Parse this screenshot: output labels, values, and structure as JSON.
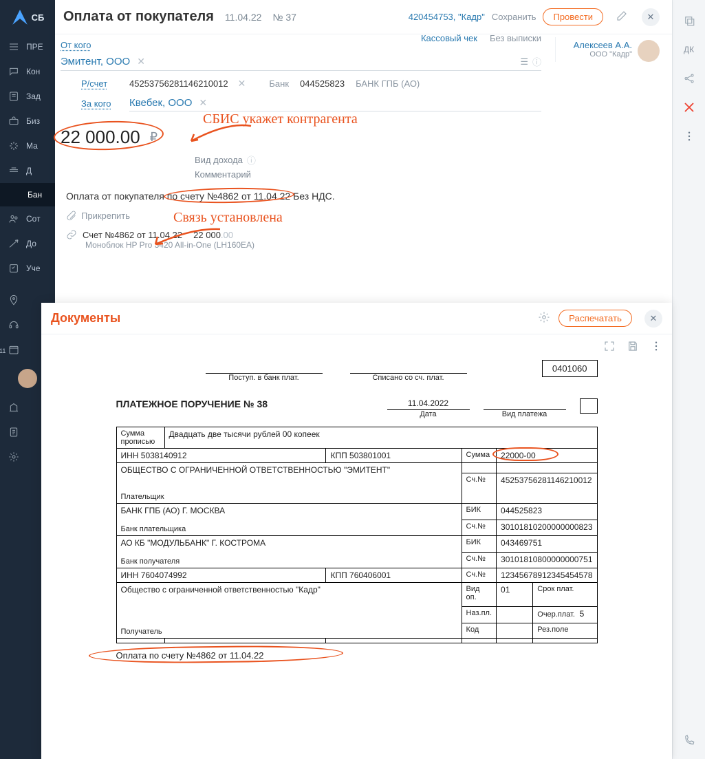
{
  "sidebar": {
    "brand": "СБ",
    "items": [
      {
        "icon": "menu",
        "label": "ПРЕ"
      },
      {
        "icon": "chat",
        "label": "Кон"
      },
      {
        "icon": "tasks",
        "label": "Зад"
      },
      {
        "icon": "briefcase",
        "label": "Биз"
      },
      {
        "icon": "spark",
        "label": "Ма"
      },
      {
        "icon": "money",
        "label": "Д"
      },
      {
        "icon": "",
        "label": "Бан",
        "sub": true,
        "active": true
      },
      {
        "icon": "people",
        "label": "Сот"
      },
      {
        "icon": "send",
        "label": "До"
      },
      {
        "icon": "ledger",
        "label": "Уче"
      },
      {
        "icon": "",
        "label": ""
      },
      {
        "icon": "geo",
        "label": ""
      },
      {
        "icon": "headset",
        "label": ""
      },
      {
        "icon": "calendar",
        "label": "11"
      },
      {
        "icon": "avatar",
        "label": ""
      },
      {
        "icon": "bank",
        "label": ""
      },
      {
        "icon": "clipboard",
        "label": ""
      },
      {
        "icon": "gear",
        "label": ""
      }
    ]
  },
  "topbar": {
    "title": "Оплата от покупателя",
    "date": "11.04.22",
    "num": "№ 37",
    "org_ref": "420454753, \"Кадр\"",
    "save": "Сохранить",
    "submit": "Провести"
  },
  "statement": {
    "cashcheck": "Кассовый чек",
    "nostatement": "Без выписки"
  },
  "person": {
    "name": "Алексеев А.А.",
    "company": "ООО \"Кадр\""
  },
  "form": {
    "from_lbl": "От кого",
    "from_company": "Эмитент, ООО",
    "acc_lbl": "Р/счет",
    "acc_value": "45253756281146210012",
    "bank_lbl": "Банк",
    "bik_value": "044525823",
    "bank_name": "БАНК ГПБ (АО)",
    "for_lbl": "За кого",
    "for_company": "Квебек, ООО",
    "amount": "22 000.00",
    "currency": "₽",
    "income_type_lbl": "Вид дохода",
    "comment_lbl": "Комментарий",
    "hw1": "СБИС укажет контрагента",
    "hw2": "Связь установлена"
  },
  "desc": "Оплата от покупателя по счету №4862 от 11.04.22 Без НДС.",
  "desc_highlight": "по счету №4862 от 11.04.22",
  "attach_lbl": "Прикрепить",
  "linked": {
    "title": "Счет №4862 от 11.04.22",
    "amount_main": "22 000",
    "amount_dec": ".00",
    "sub": "Моноблок HP Pro 3420 All-in-One (LH160EA)"
  },
  "docpanel": {
    "title": "Документы",
    "print": "Распечатать"
  },
  "po": {
    "code": "0401060",
    "lbl_in": "Поступ. в банк плат.",
    "lbl_out": "Списано со сч. плат.",
    "heading": "ПЛАТЕЖНОЕ ПОРУЧЕНИЕ № 38",
    "date": "11.04.2022",
    "date_lbl": "Дата",
    "type_lbl": "Вид платежа",
    "sum_words_lbl": "Сумма прописью",
    "sum_words": "Двадцать две тысячи рублей 00 копеек",
    "inn_payer": "ИНН 5038140912",
    "kpp_payer": "КПП 503801001",
    "sum_lbl": "Сумма",
    "sum_val": "22000-00",
    "payer_name": "ОБЩЕСТВО С ОГРАНИЧЕННОЙ ОТВЕТСТВЕННОСТЬЮ \"ЭМИТЕНТ\"",
    "acc_lbl": "Сч.№",
    "payer_acc": "45253756281146210012",
    "payer_lbl": "Плательщик",
    "payer_bank": "БАНК ГПБ (АО) Г. МОСКВА",
    "bik_lbl": "БИК",
    "payer_bik": "044525823",
    "payer_bank_acc": "30101810200000000823",
    "payer_bank_lbl": "Банк плательщика",
    "rec_bank": "АО КБ \"МОДУЛЬБАНК\" Г. КОСТРОМА",
    "rec_bik": "043469751",
    "rec_bank_acc": "30101810800000000751",
    "rec_bank_lbl": "Банк получателя",
    "inn_rec": "ИНН 7604074992",
    "kpp_rec": "КПП 760406001",
    "rec_acc": "12345678912345454578",
    "rec_name": "Общество с ограниченной ответственностью \"Кадр\"",
    "vidop_lbl": "Вид оп.",
    "vidop": "01",
    "srok_lbl": "Срок плат.",
    "nazpl_lbl": "Наз.пл.",
    "ocher_lbl": "Очер.плат.",
    "ocher": "5",
    "kod_lbl": "Код",
    "rez_lbl": "Рез.поле",
    "rec_lbl": "Получатель",
    "purpose": "Оплата по счету №4862 от 11.04.22"
  }
}
